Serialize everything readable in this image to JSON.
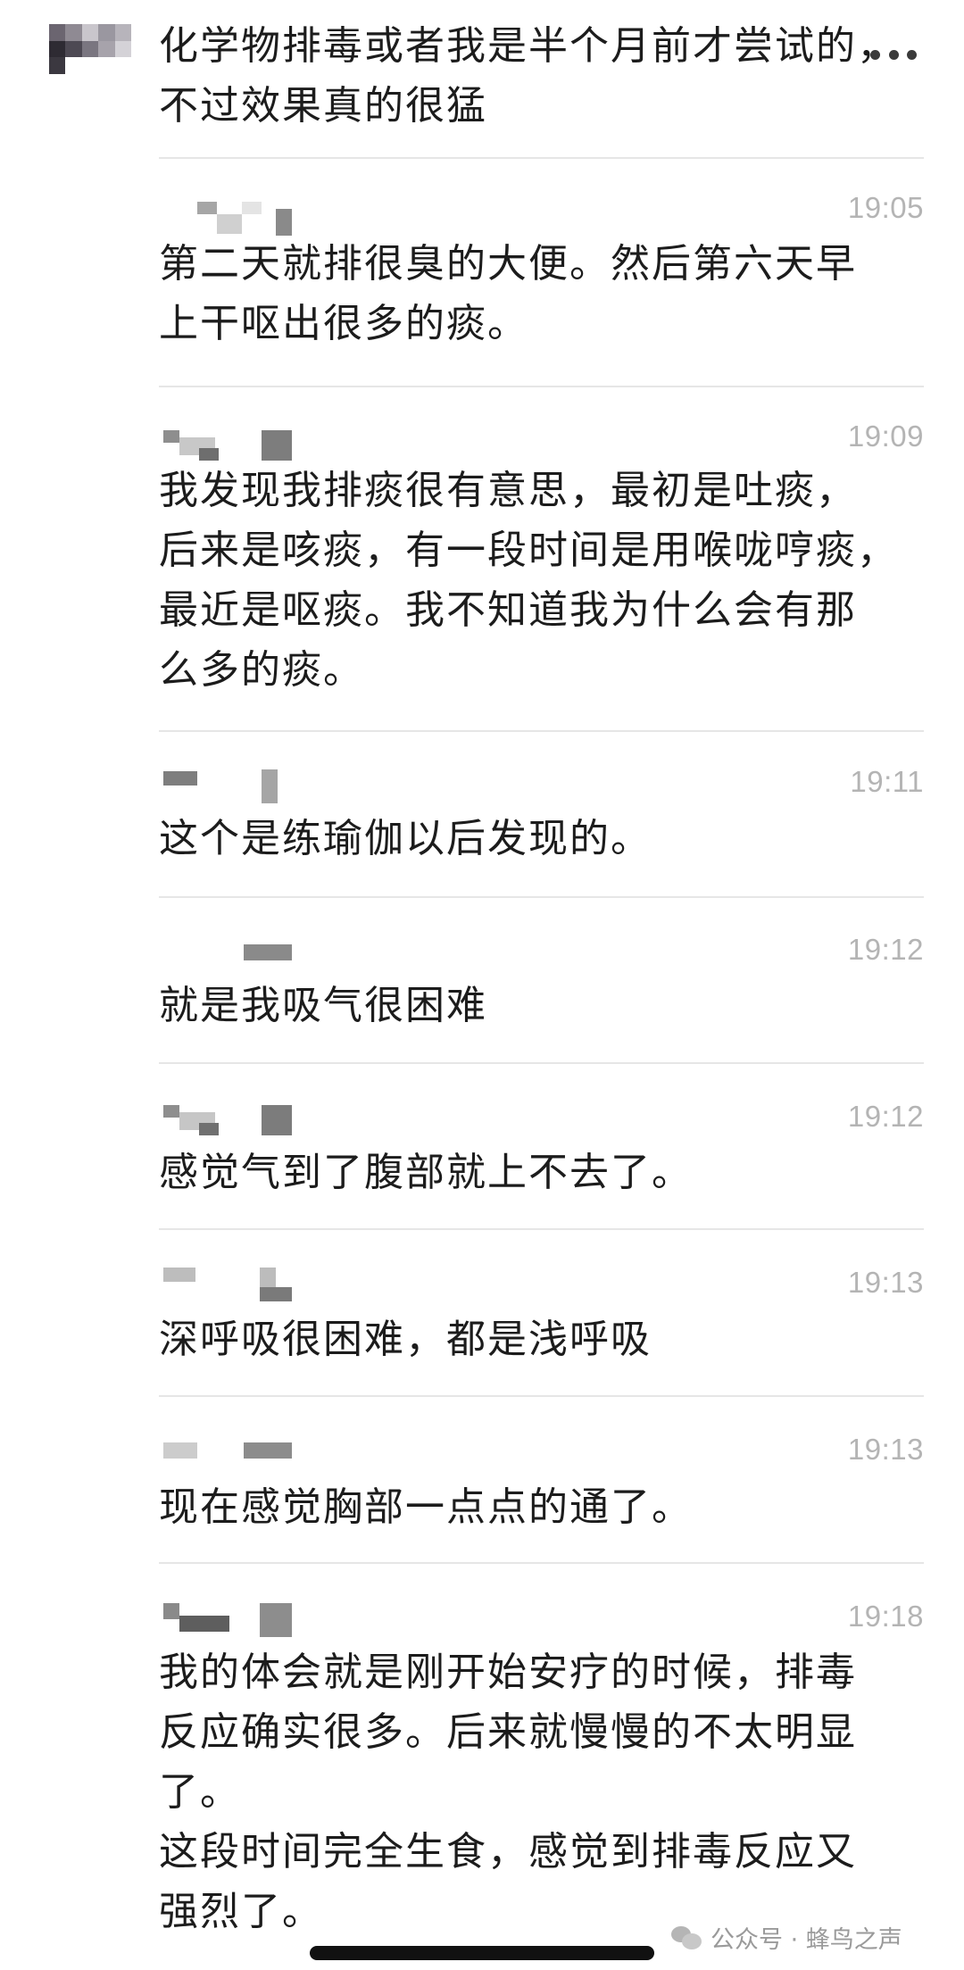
{
  "header": {
    "text": "化学物排毒或者我是半个月前才尝试的，\n不过效果真的很猛"
  },
  "messages": [
    {
      "time": "19:05",
      "text": "第二天就排很臭的大便。然后第六天早\n上干呕出很多的痰。"
    },
    {
      "time": "19:09",
      "text": "我发现我排痰很有意思，最初是吐痰，\n后来是咳痰，有一段时间是用喉咙哼痰，\n最近是呕痰。我不知道我为什么会有那\n么多的痰。"
    },
    {
      "time": "19:11",
      "text": "这个是练瑜伽以后发现的。"
    },
    {
      "time": "19:12",
      "text": "就是我吸气很困难"
    },
    {
      "time": "19:12",
      "text": "感觉气到了腹部就上不去了。"
    },
    {
      "time": "19:13",
      "text": "深呼吸很困难，都是浅呼吸"
    },
    {
      "time": "19:13",
      "text": "现在感觉胸部一点点的通了。"
    },
    {
      "time": "19:18",
      "text": "我的体会就是刚开始安疗的时候，排毒\n反应确实很多。后来就慢慢的不太明显\n了。\n这段时间完全生食，感觉到排毒反应又\n强烈了。"
    }
  ],
  "watermark": {
    "text": "公众号 · 蜂鸟之声",
    "icon": "wechat-icon"
  },
  "icons": {
    "more": "more-dots-icon"
  }
}
